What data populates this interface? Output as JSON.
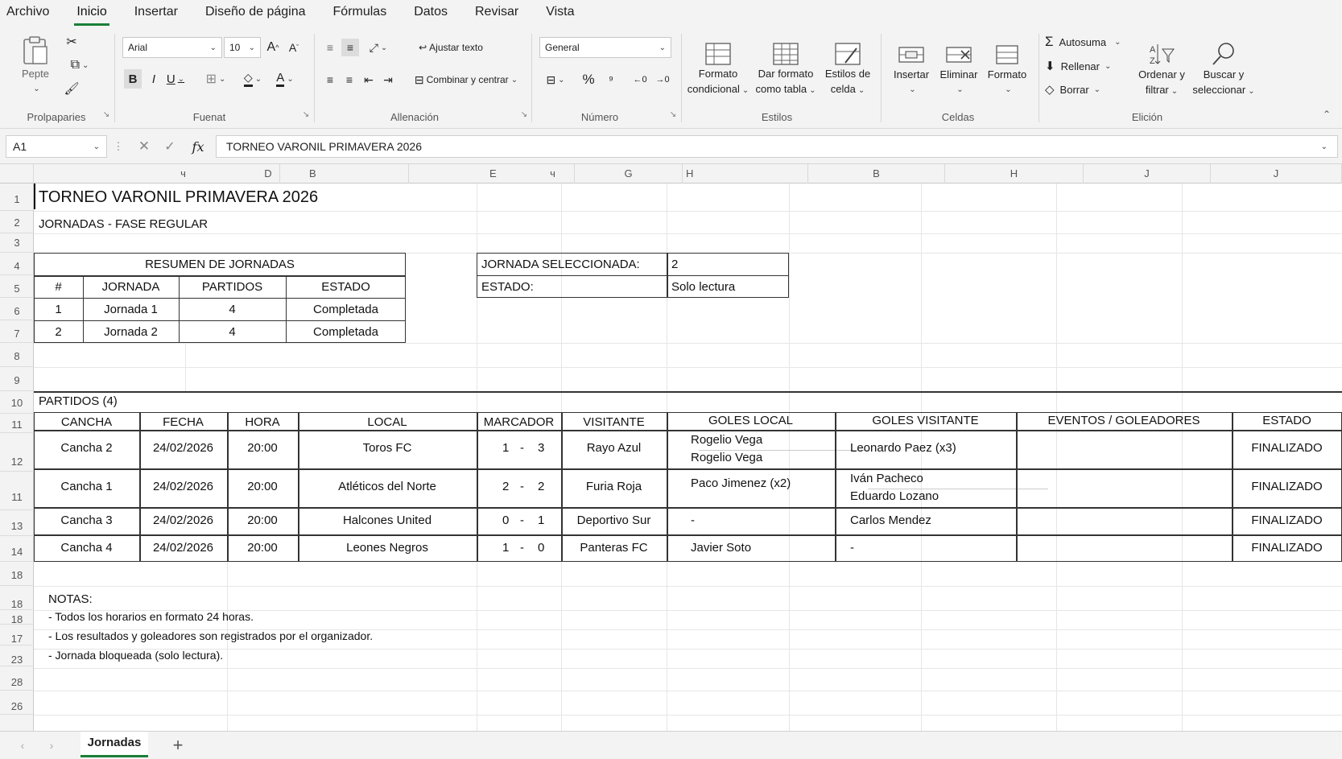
{
  "menu": [
    "Archivo",
    "Inicio",
    "Insertar",
    "Diseño de página",
    "Fórmulas",
    "Datos",
    "Revisar",
    "Vista"
  ],
  "ribbon": {
    "clipboard": {
      "paste": "Pepte",
      "label": "Prolpaparies"
    },
    "font": {
      "name": "Arial",
      "size": "10",
      "label": "Fuenat"
    },
    "alignment": {
      "wrap": "Ajustar texto",
      "merge": "Combinar y centrar",
      "label": "Allenación"
    },
    "number": {
      "format": "General",
      "label": "Número"
    },
    "styles": {
      "cond1": "Formato",
      "cond2": "condicional",
      "table1": "Dar formato",
      "table2": "como tabla",
      "cell1": "Estilos de",
      "cell2": "celda",
      "label": "Estilos"
    },
    "cells": {
      "insert": "Insertar",
      "delete": "Eliminar",
      "format": "Formato",
      "label": "Celdas"
    },
    "editing": {
      "autosum": "Autosuma",
      "fill": "Rellenar",
      "clear": "Borrar",
      "sort1": "Ordenar y",
      "sort2": "filtrar",
      "find1": "Buscar y",
      "find2": "seleccionar",
      "label": "Elición"
    }
  },
  "formula": {
    "cell": "A1",
    "content": "TORNEO VARONIL PRIMAVERA 2026"
  },
  "columns": [
    "ч",
    "D",
    "B",
    "E",
    "ч",
    "G",
    "H",
    "B",
    "H",
    "J",
    "J"
  ],
  "rows": [
    "1",
    "2",
    "3",
    "4",
    "5",
    "6",
    "7",
    "8",
    "9",
    "10",
    "11",
    "12",
    "11",
    "13",
    "14",
    "18",
    "18",
    "18",
    "17",
    "23",
    "28",
    "26"
  ],
  "sheet": {
    "title": "TORNEO VARONIL PRIMAVERA 2026",
    "subtitle": "JORNADAS - FASE REGULAR",
    "summary": {
      "title": "RESUMEN DE JORNADAS",
      "headers": [
        "#",
        "JORNADA",
        "PARTIDOS",
        "ESTADO"
      ],
      "rows": [
        [
          "1",
          "Jornada 1",
          "4",
          "Completada"
        ],
        [
          "2",
          "Jornada 2",
          "4",
          "Completada"
        ]
      ]
    },
    "selected": {
      "label1": "JORNADA SELECCIONADA:",
      "value1": "2",
      "label2": "ESTADO:",
      "value2": "Solo lectura"
    },
    "matches_title": "PARTIDOS (4)",
    "match_headers": [
      "CANCHA",
      "FECHA",
      "HORA",
      "LOCAL",
      "MARCADOR",
      "VISITANTE",
      "GOLES LOCAL",
      "GOLES VISITANTE",
      "EVENTOS / GOLEADORES",
      "ESTADO"
    ],
    "matches": [
      {
        "cancha": "Cancha 2",
        "fecha": "24/02/2026",
        "hora": "20:00",
        "local": "Toros FC",
        "m1": "1",
        "sep": "-",
        "m2": "3",
        "visitante": "Rayo Azul",
        "gl1": "Rogelio Vega",
        "gl2": "Rogelio Vega",
        "gv1": "Leonardo Paez (x3)",
        "gv2": "",
        "estado": "FINALIZADO"
      },
      {
        "cancha": "Cancha 1",
        "fecha": "24/02/2026",
        "hora": "20:00",
        "local": "Atléticos del Norte",
        "m1": "2",
        "sep": "-",
        "m2": "2",
        "visitante": "Furia Roja",
        "gl1": "Paco Jimenez (x2)",
        "gl2": "",
        "gv1": "Iván Pacheco",
        "gv2": "Eduardo Lozano",
        "estado": "FINALIZADO"
      },
      {
        "cancha": "Cancha 3",
        "fecha": "24/02/2026",
        "hora": "20:00",
        "local": "Halcones United",
        "m1": "0",
        "sep": "-",
        "m2": "1",
        "visitante": "Deportivo Sur",
        "gl1": "-",
        "gl2": "",
        "gv1": "Carlos Mendez",
        "gv2": "",
        "estado": "FINALIZADO"
      },
      {
        "cancha": "Cancha 4",
        "fecha": "24/02/2026",
        "hora": "20:00",
        "local": "Leones Negros",
        "m1": "1",
        "sep": "-",
        "m2": "0",
        "visitante": "Panteras FC",
        "gl1": "Javier Soto",
        "gl2": "",
        "gv1": "-",
        "gv2": "",
        "estado": "FINALIZADO"
      }
    ],
    "notes": [
      "NOTAS:",
      "- Todos los horarios en formato 24 horas.",
      "- Los resultados y goleadores son registrados por el organizador.",
      "- Jornada bloqueada (solo lectura)."
    ]
  },
  "tabs": {
    "active": "Jornadas",
    "add": "+"
  }
}
